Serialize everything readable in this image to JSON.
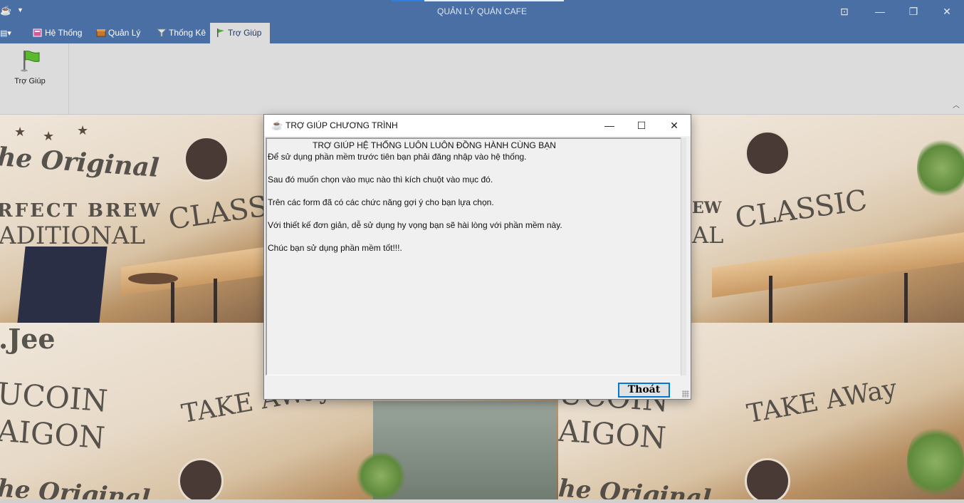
{
  "window": {
    "title": "QUẢN LÝ QUÁN CAFE",
    "app_icon": "coffee-cup-icon",
    "controls": {
      "restore_ribbon": "⊡",
      "minimize": "—",
      "maximize": "❐",
      "close": "✕"
    }
  },
  "ribbon": {
    "quick_menu": "▤▾",
    "tabs": [
      {
        "label": "Hệ Thống",
        "icon": "notebook-icon",
        "active": false
      },
      {
        "label": "Quản Lý",
        "icon": "box-icon",
        "active": false
      },
      {
        "label": "Thống Kê",
        "icon": "funnel-icon",
        "active": false
      },
      {
        "label": "Trợ Giúp",
        "icon": "flag-icon",
        "active": true
      }
    ],
    "buttons": [
      {
        "label": "Trợ Giúp",
        "icon": "green-flag-icon"
      }
    ],
    "collapse_glyph": "︿"
  },
  "background": {
    "words": {
      "original": "he Original",
      "perfect_brew": "RFECT BREW",
      "traditional": "ADITIONAL",
      "classic": "CLASSIC",
      "classic2": "CLASSIC",
      "traditional2": "AL",
      "brew2": "EW",
      "cafee": ".Jee",
      "ducoin": "UCOIN",
      "saigon": "AIGON",
      "takeaway": "TAKE AWay",
      "ducoin2": "UCOIN",
      "saigon2": "AIGON",
      "takeaway2": "TAKE AWay",
      "original2": "he Original",
      "original3": "he Original"
    }
  },
  "dialog": {
    "title": "TRỢ GIÚP CHƯƠNG TRÌNH",
    "icon": "coffee-cup-icon",
    "controls": {
      "minimize": "—",
      "maximize": "☐",
      "close": "✕"
    },
    "heading": "TRỢ GIÚP HỆ THỐNG LUÔN LUÔN ĐỒNG HÀNH CÙNG BẠN",
    "lines": [
      "Để sử dụng phần mềm trước tiên bạn phải đăng nhập vào hệ thống.",
      "Sau đó muốn chọn vào mục nào thì kích chuột vào mục đó.",
      "Trên các form đã có các chức năng gợi ý cho bạn lựa chọn.",
      "Với thiết kế đơn giản, dễ sử dụng hy vọng bạn sẽ hài lòng với phần mềm này.",
      "Chúc bạn sử dụng phần mềm tốt!!!."
    ],
    "exit_label": "Thoát"
  }
}
